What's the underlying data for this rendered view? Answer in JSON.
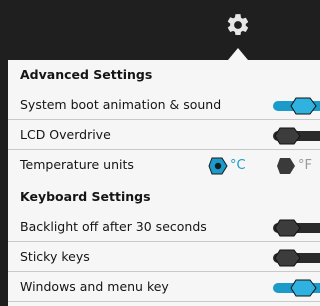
{
  "header": {
    "icon": "gear-icon"
  },
  "colors": {
    "accent": "#1a9bc9",
    "toggle_off": "#2a2a2a",
    "panel_bg": "#f6f6f6",
    "header_bg": "#1f1f1f",
    "unit_off": "#9a9a9a"
  },
  "advanced": {
    "title": "Advanced Settings",
    "boot_animation": {
      "label": "System boot animation & sound",
      "on": true
    },
    "lcd_overdrive": {
      "label": "LCD Overdrive",
      "on": false
    },
    "temperature": {
      "label": "Temperature units",
      "celsius": "°C",
      "fahrenheit": "°F",
      "selected": "celsius"
    }
  },
  "keyboard": {
    "title": "Keyboard Settings",
    "backlight_off": {
      "label": "Backlight off after 30 seconds",
      "on": false
    },
    "sticky_keys": {
      "label": "Sticky keys",
      "on": false
    },
    "windows_menu_key": {
      "label": "Windows and menu key",
      "on": true
    }
  }
}
